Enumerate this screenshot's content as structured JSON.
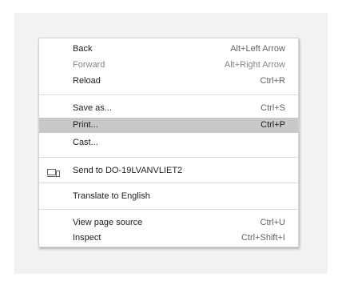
{
  "menu": {
    "back": {
      "label": "Back",
      "shortcut": "Alt+Left Arrow"
    },
    "forward": {
      "label": "Forward",
      "shortcut": "Alt+Right Arrow"
    },
    "reload": {
      "label": "Reload",
      "shortcut": "Ctrl+R"
    },
    "save_as": {
      "label": "Save as...",
      "shortcut": "Ctrl+S"
    },
    "print": {
      "label": "Print...",
      "shortcut": "Ctrl+P"
    },
    "cast": {
      "label": "Cast..."
    },
    "send_to": {
      "label": "Send to DO-19LVANVLIET2",
      "icon": "send-to-device-icon"
    },
    "translate": {
      "label": "Translate to English"
    },
    "view_source": {
      "label": "View page source",
      "shortcut": "Ctrl+U"
    },
    "inspect": {
      "label": "Inspect",
      "shortcut": "Ctrl+Shift+I"
    }
  },
  "colors": {
    "highlight": "#c8c8c8",
    "disabled_text": "#80868b",
    "backdrop": "#f1f2f4"
  }
}
